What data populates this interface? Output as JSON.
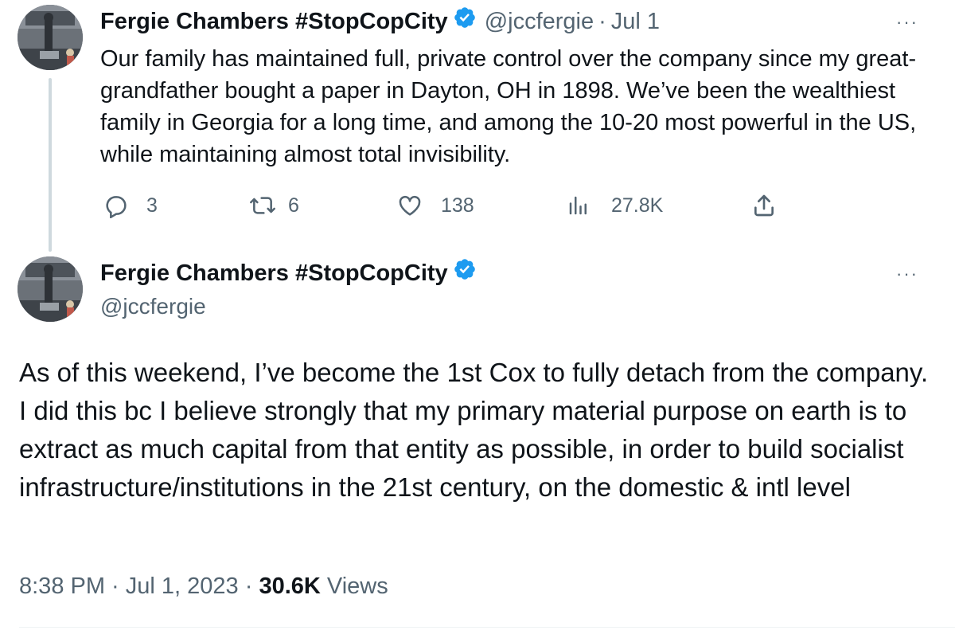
{
  "tweet1": {
    "author_name": "Fergie Chambers #StopCopCity",
    "handle": "@jccfergie",
    "separator": "·",
    "date": "Jul 1",
    "more": "···",
    "text": "Our family has maintained full, private control over the company since my great-grandfather bought a paper in Dayton, OH in 1898. We’ve been the wealthiest family in Georgia for a long time, and among the 10-20 most powerful in the US, while maintaining almost total invisibility.",
    "actions": {
      "replies": "3",
      "retweets": "6",
      "likes": "138",
      "views": "27.8K"
    }
  },
  "tweet2": {
    "author_name": "Fergie Chambers #StopCopCity",
    "handle": "@jccfergie",
    "more": "···",
    "text": "As of this weekend, I’ve become the 1st Cox to fully detach from the company. I did this bc I believe strongly that my primary material purpose on earth is to extract as much capital from that entity as possible, in order to build socialist infrastructure/institutions in the 21st century, on the domestic & intl level",
    "time": "8:38 PM",
    "sep1": " · ",
    "date": "Jul 1, 2023",
    "sep2": " · ",
    "views_count": "30.6K",
    "views_label": " Views"
  },
  "icons": {
    "verified": "verified-badge-icon",
    "reply": "reply-icon",
    "retweet": "retweet-icon",
    "like": "heart-icon",
    "views": "analytics-icon",
    "share": "share-icon"
  },
  "colors": {
    "verified_blue": "#1d9bf0",
    "text_primary": "#0f1419",
    "text_secondary": "#536471",
    "thread_line": "#cfd9de"
  }
}
